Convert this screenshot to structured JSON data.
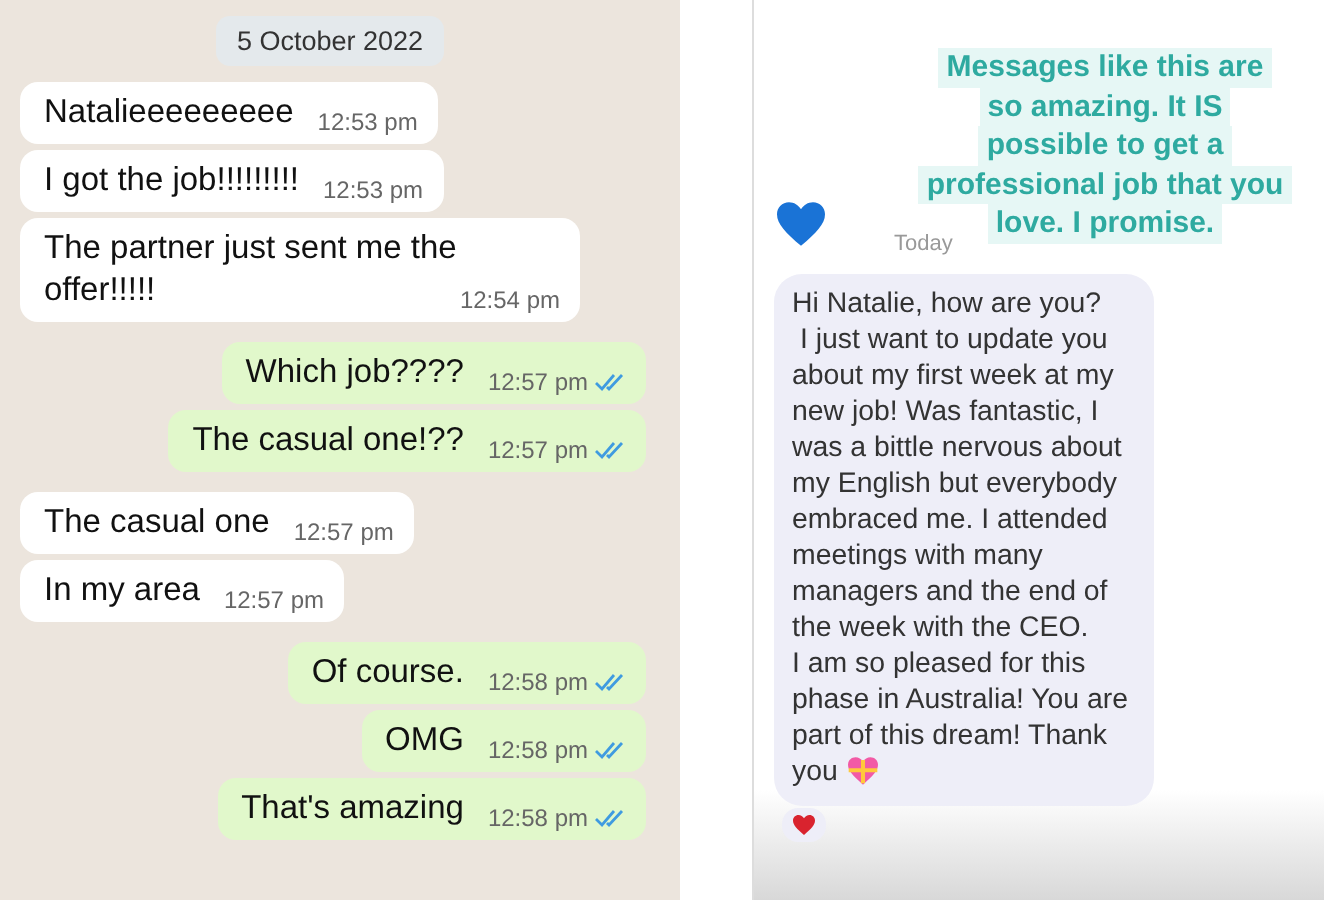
{
  "left_chat": {
    "date": "5 October 2022",
    "messages": [
      {
        "kind": "incoming",
        "text": "Natalieeeeeeeee",
        "time": "12:53 pm"
      },
      {
        "kind": "incoming",
        "text": "I got the job!!!!!!!!!",
        "time": "12:53 pm"
      },
      {
        "kind": "incoming",
        "text": "The partner just sent me the offer!!!!!",
        "time": "12:54 pm"
      },
      {
        "kind": "outgoing",
        "text": "Which job????",
        "time": "12:57 pm"
      },
      {
        "kind": "outgoing",
        "text": "The casual one!??",
        "time": "12:57 pm"
      },
      {
        "kind": "incoming",
        "text": "The casual one",
        "time": "12:57 pm"
      },
      {
        "kind": "incoming",
        "text": "In my area",
        "time": "12:57 pm"
      },
      {
        "kind": "outgoing",
        "text": "Of course.",
        "time": "12:58 pm"
      },
      {
        "kind": "outgoing",
        "text": "OMG",
        "time": "12:58 pm"
      },
      {
        "kind": "outgoing",
        "text": "That's amazing",
        "time": "12:58 pm"
      }
    ]
  },
  "right_chat": {
    "caption_lines": [
      "Messages like this are",
      "so amazing. It IS",
      "possible to get a",
      "professional job that you",
      "love. I promise."
    ],
    "timestamp": "Today",
    "message": {
      "lines": [
        "Hi Natalie, how are you?",
        " I just want to update you about my first week at my new job! Was fantastic, I was a bittle nervous about my English but everybody embraced me. I attended meetings with many managers and the end of the week with the CEO.",
        "I am so pleased for this phase in Australia! You are part of this dream! Thank you"
      ]
    }
  }
}
